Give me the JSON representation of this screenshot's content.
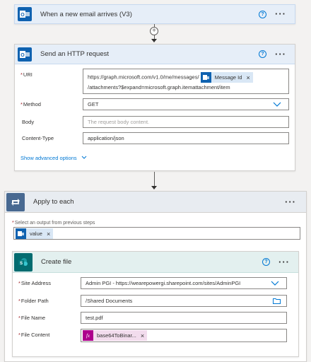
{
  "trigger": {
    "title": "When a new email arrives (V3)",
    "help": "?",
    "more": "···"
  },
  "http": {
    "title": "Send an HTTP request",
    "help": "?",
    "more": "···",
    "uri_label": "URI",
    "uri_text_1": "https://graph.microsoft.com/v1.0/me/messages/",
    "uri_token": "Message Id",
    "uri_text_2": "/attachments?$expand=microsoft.graph.itemattachment/item",
    "method_label": "Method",
    "method_value": "GET",
    "body_label": "Body",
    "body_placeholder": "The request body content.",
    "content_type_label": "Content-Type",
    "content_type_value": "application/json",
    "advanced": "Show advanced options"
  },
  "loop": {
    "title": "Apply to each",
    "more": "···",
    "select_label": "Select an output from previous steps",
    "token": "value"
  },
  "create_file": {
    "title": "Create file",
    "help": "?",
    "more": "···",
    "site_label": "Site Address",
    "site_value": "Admin PGI - https://wearepowergi.sharepoint.com/sites/AdminPGI",
    "folder_label": "Folder Path",
    "folder_value": "/Shared Documents",
    "name_label": "File Name",
    "name_value": "test.pdf",
    "content_label": "File Content",
    "content_token": "base64ToBinar...",
    "fx": "fx"
  },
  "colors": {
    "outlook": "#0f62b0",
    "loop": "#486991",
    "sharepoint": "#036c70",
    "expression": "#ad008c",
    "link": "#0078d4"
  }
}
